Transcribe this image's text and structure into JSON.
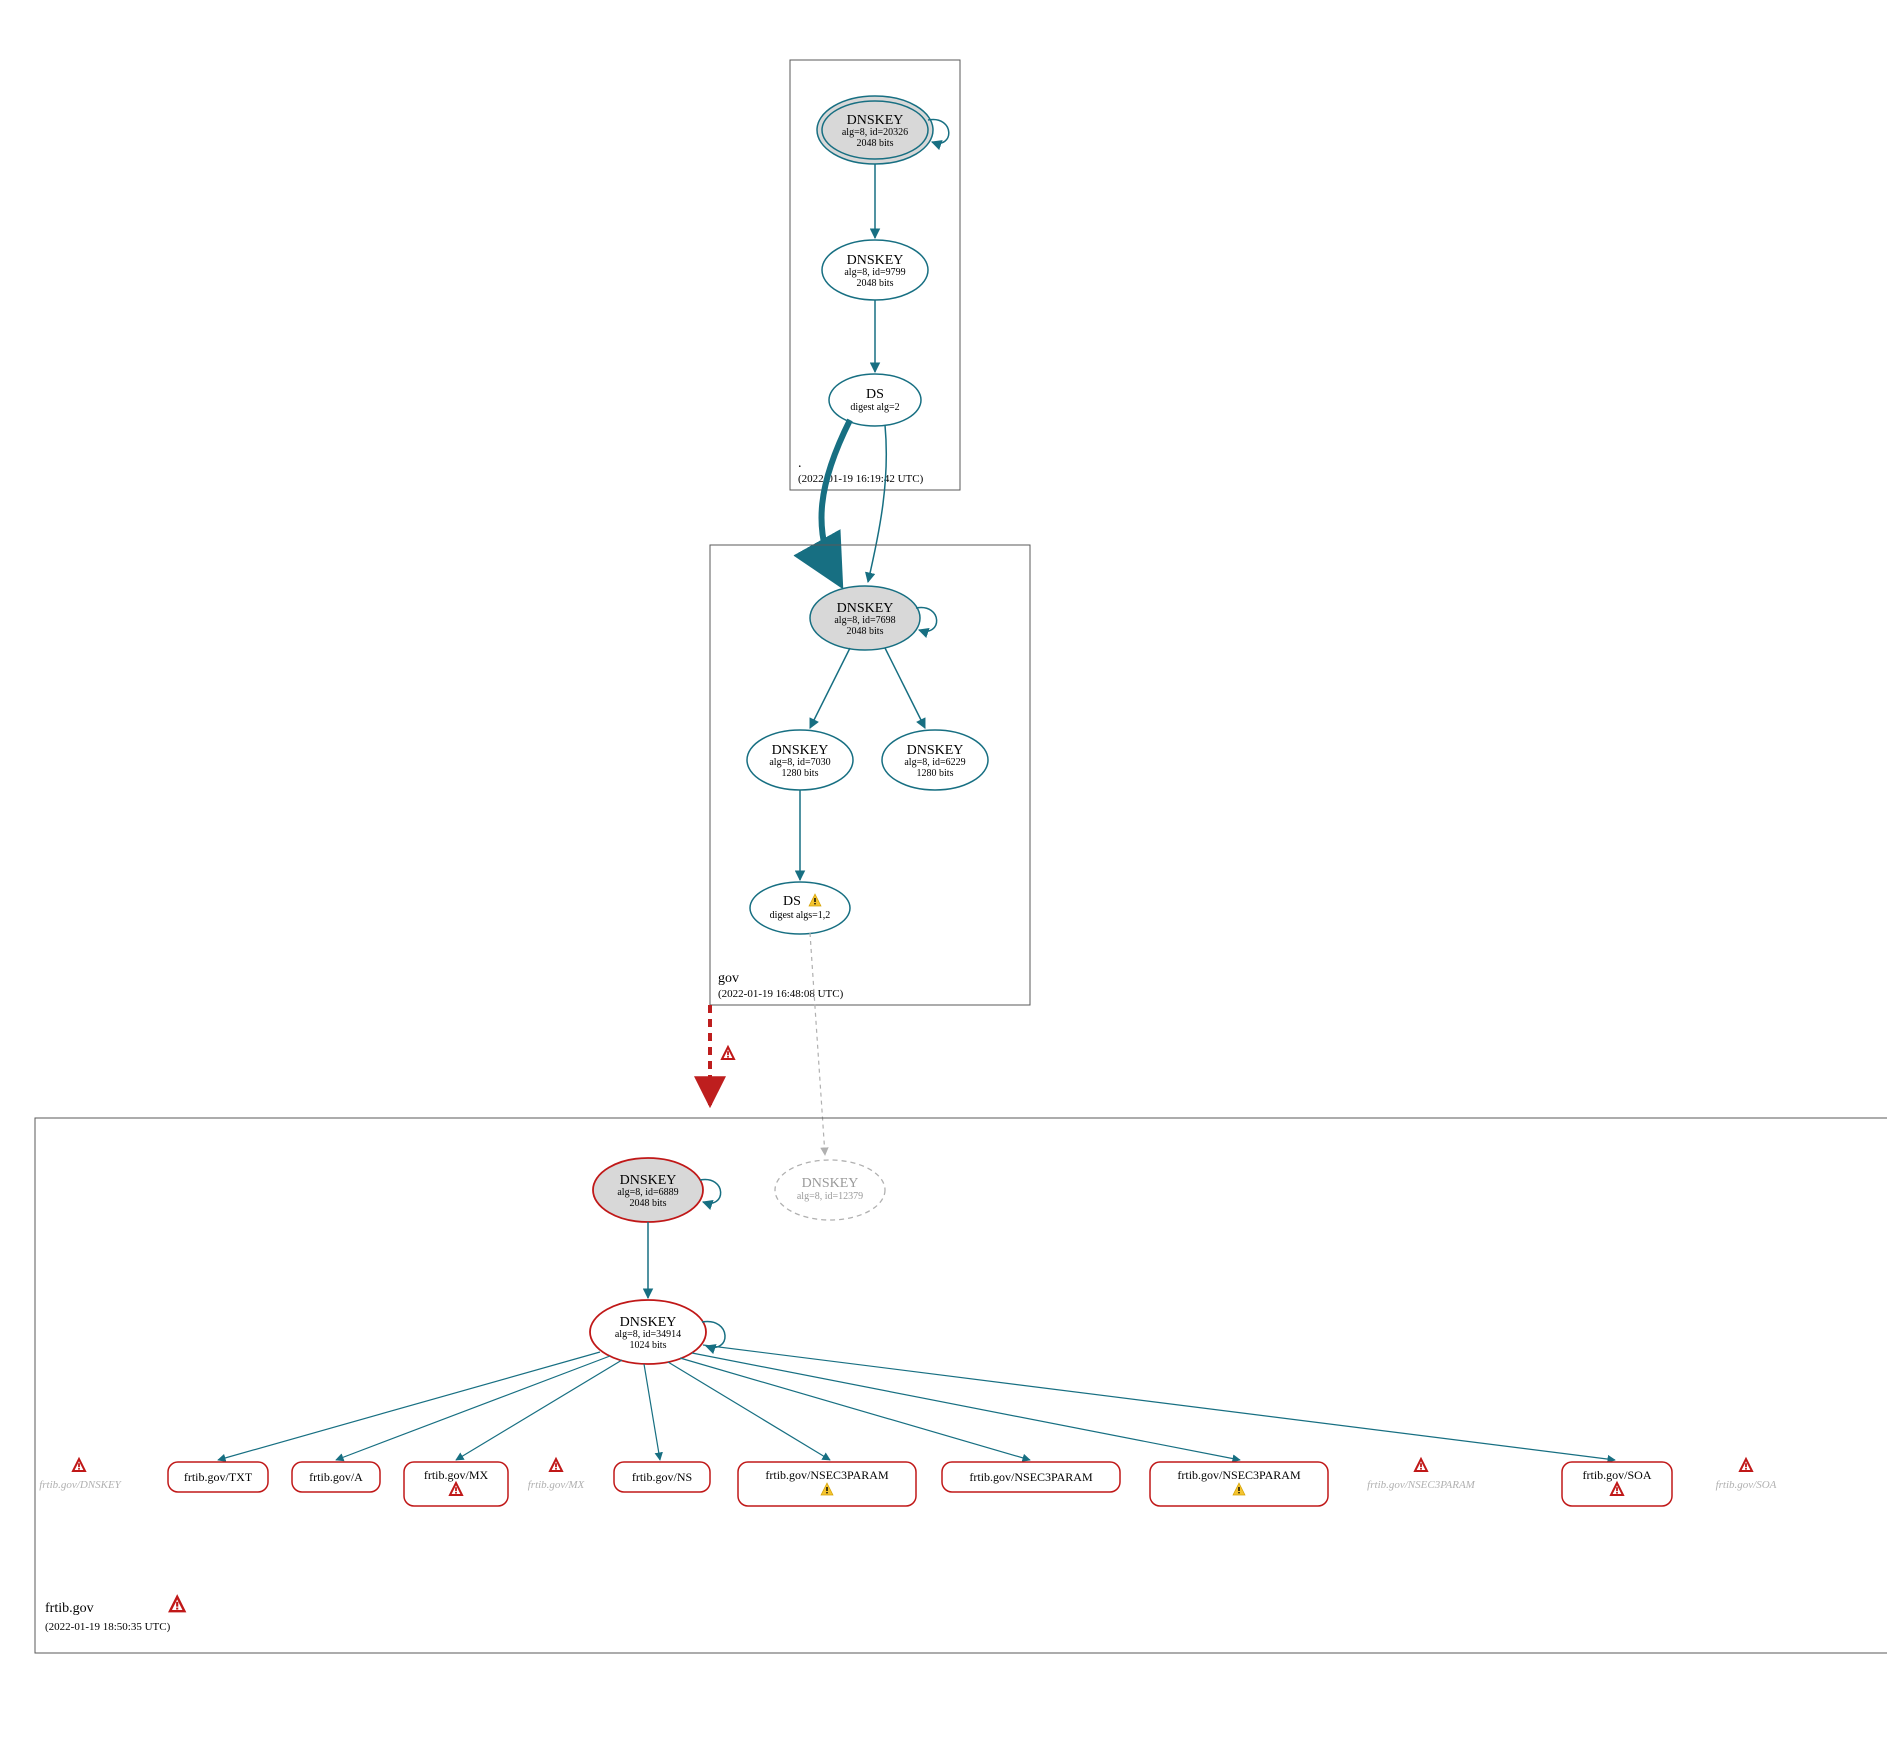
{
  "zones": {
    "root": {
      "label": ".",
      "timestamp": "(2022-01-19 16:19:42 UTC)",
      "nodes": {
        "dnskey1": {
          "title": "DNSKEY",
          "line2": "alg=8, id=20326",
          "line3": "2048 bits"
        },
        "dnskey2": {
          "title": "DNSKEY",
          "line2": "alg=8, id=9799",
          "line3": "2048 bits"
        },
        "ds": {
          "title": "DS",
          "line2": "digest alg=2"
        }
      }
    },
    "gov": {
      "label": "gov",
      "timestamp": "(2022-01-19 16:48:08 UTC)",
      "nodes": {
        "dnskey1": {
          "title": "DNSKEY",
          "line2": "alg=8, id=7698",
          "line3": "2048 bits"
        },
        "dnskey2": {
          "title": "DNSKEY",
          "line2": "alg=8, id=7030",
          "line3": "1280 bits"
        },
        "dnskey3": {
          "title": "DNSKEY",
          "line2": "alg=8, id=6229",
          "line3": "1280 bits"
        },
        "ds": {
          "title": "DS",
          "line2": "digest algs=1,2"
        }
      }
    },
    "frtib": {
      "label": "frtib.gov",
      "timestamp": "(2022-01-19 18:50:35 UTC)",
      "nodes": {
        "dnskey1": {
          "title": "DNSKEY",
          "line2": "alg=8, id=6889",
          "line3": "2048 bits"
        },
        "dnskey2": {
          "title": "DNSKEY",
          "line2": "alg=8, id=34914",
          "line3": "1024 bits"
        },
        "dnskey_ghost": {
          "title": "DNSKEY",
          "line2": "alg=8, id=12379"
        }
      },
      "records": {
        "txt": "frtib.gov/TXT",
        "a": "frtib.gov/A",
        "mx": "frtib.gov/MX",
        "ns": "frtib.gov/NS",
        "nsec3_1": "frtib.gov/NSEC3PARAM",
        "nsec3_2": "frtib.gov/NSEC3PARAM",
        "nsec3_3": "frtib.gov/NSEC3PARAM",
        "soa": "frtib.gov/SOA"
      },
      "ghosts": {
        "dnskey": "frtib.gov/DNSKEY",
        "mx": "frtib.gov/MX",
        "nsec3": "frtib.gov/NSEC3PARAM",
        "soa": "frtib.gov/SOA"
      }
    }
  }
}
